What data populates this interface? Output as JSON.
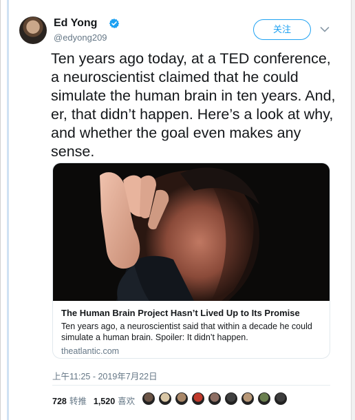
{
  "author": {
    "name": "Ed Yong",
    "handle": "@edyong209"
  },
  "follow_button": {
    "label": "关注"
  },
  "tweet": {
    "text": "Ten years ago today, at a TED conference, a neuroscientist claimed that he could simulate the human brain in ten years. And, er, that didn’t happen. Here’s a look at why, and whether the goal even makes any sense."
  },
  "card": {
    "title": "The Human Brain Project Hasn’t Lived Up to Its Promise",
    "description": "Ten years ago, a neuroscientist said that within a decade he could simulate a human brain. Spoiler: It didn’t happen.",
    "domain": "theatlantic.com"
  },
  "timestamp": "上午11:25 - 2019年7月22日",
  "stats": {
    "retweets_count": "728",
    "retweets_label": "转推",
    "likes_count": "1,520",
    "likes_label": "喜欢"
  },
  "colors": {
    "accent": "#1da1f2",
    "text": "#14171a",
    "muted": "#657786"
  },
  "icons": {
    "verified": "verified-badge-icon",
    "menu": "chevron-down-icon"
  },
  "likers": [
    {
      "color": "#6b5446"
    },
    {
      "color": "#d9c7a6"
    },
    {
      "color": "#a98768"
    },
    {
      "color": "#c0392b"
    },
    {
      "color": "#8d6e63"
    },
    {
      "color": "#404040"
    },
    {
      "color": "#b89878"
    },
    {
      "color": "#6a7f4f"
    },
    {
      "color": "#3d3d3d"
    }
  ]
}
